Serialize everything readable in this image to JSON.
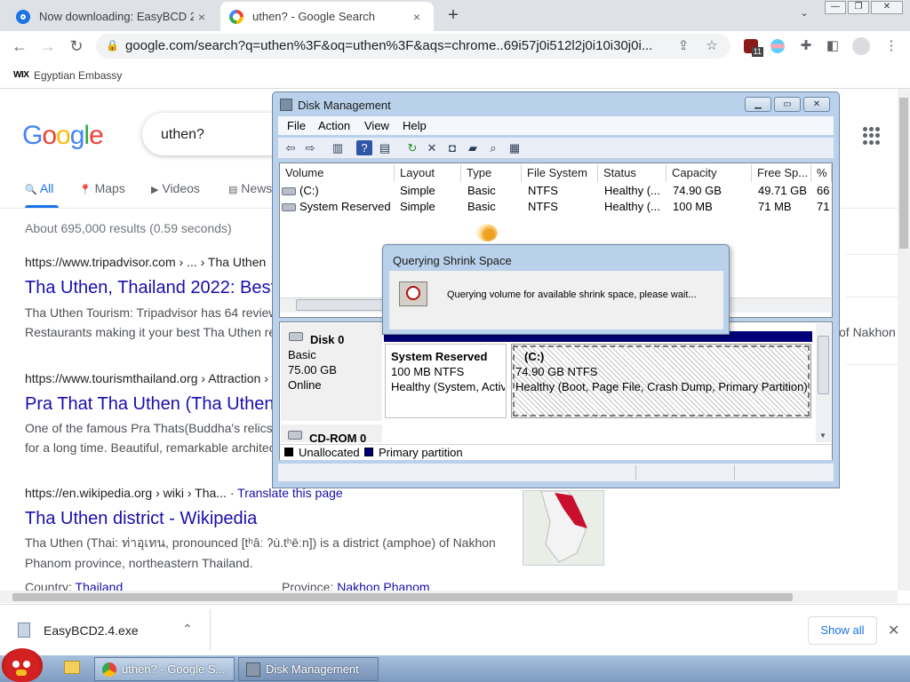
{
  "browser": {
    "tabs": [
      {
        "title": "Now downloading: EasyBCD 2",
        "close": "×"
      },
      {
        "title": "uthen? - Google Search",
        "close": "×"
      }
    ],
    "new_tab": "+",
    "tab_search": "⌄",
    "window_controls": {
      "minimize": "—",
      "restore": "❐",
      "close": "✕"
    },
    "nav": {
      "back": "←",
      "forward": "→",
      "reload": "↻"
    },
    "url": "google.com/search?q=uthen%3F&oq=uthen%3F&aqs=chrome..69i57j0i512l2j0i10i30j0i...",
    "extension_badge": "11",
    "bookmarks": [
      {
        "icon_text": "WIX",
        "label": "Egyptian Embassy"
      }
    ]
  },
  "google": {
    "logo": "Google",
    "query": "uthen?",
    "tabs": [
      "All",
      "Maps",
      "Videos",
      "News"
    ],
    "tab_icons": [
      "🔍",
      "📍",
      "▶",
      "▤"
    ],
    "stats": "About 695,000 results (0.59 seconds)",
    "results": [
      {
        "cite": "https://www.tripadvisor.com › ... › Tha Uthen",
        "title": "Tha Uthen, Thailand 2022: Best",
        "snippet": [
          "Tha Uthen Tourism: Tripadvisor has 64 reviews",
          "Restaurants making it your best Tha Uthen re"
        ]
      },
      {
        "cite": "https://www.tourismthailand.org › Attraction ›",
        "title": "Pra That Tha Uthen (Tha Uthen",
        "snippet": [
          "One of the famous Pra Thats(Buddha's relics",
          "for a long time. Beautiful, remarkable architect"
        ]
      },
      {
        "cite": "https://en.wikipedia.org › wiki › Tha...",
        "translate": "Translate this page",
        "title": "Tha Uthen district - Wikipedia",
        "snippet": [
          "Tha Uthen (Thai: ท่าอุเทน, pronounced [tʰâː ʔù.tʰēːn]) is a district (amphoe) of Nakhon",
          "Phanom province, northeastern Thailand."
        ],
        "meta": {
          "country_label": "Country: ",
          "country": "Thailand",
          "province_label": "Province: ",
          "province": "Nakhon Phanom"
        }
      }
    ],
    "side_text": "of Nakhon"
  },
  "download_shelf": {
    "file": "EasyBCD2.4.exe",
    "show_all": "Show all",
    "close": "✕",
    "chevron": "⌃"
  },
  "taskbar": {
    "items": [
      {
        "label": "uthen? - Google S..."
      },
      {
        "label": "Disk Management"
      }
    ]
  },
  "disk_management": {
    "title": "Disk Management",
    "menu": [
      "File",
      "Action",
      "View",
      "Help"
    ],
    "columns": [
      "Volume",
      "Layout",
      "Type",
      "File System",
      "Status",
      "Capacity",
      "Free Sp...",
      "%"
    ],
    "volumes": [
      [
        "(C:)",
        "Simple",
        "Basic",
        "NTFS",
        "Healthy (...",
        "74.90 GB",
        "49.71 GB",
        "66"
      ],
      [
        "System Reserved",
        "Simple",
        "Basic",
        "NTFS",
        "Healthy (...",
        "100 MB",
        "71 MB",
        "71"
      ]
    ],
    "disk0": {
      "name": "Disk 0",
      "type": "Basic",
      "size": "75.00 GB",
      "state": "Online"
    },
    "partitions": [
      {
        "name": "System Reserved",
        "size": "100 MB NTFS",
        "status": "Healthy (System, Activ"
      },
      {
        "name": "(C:)",
        "size": "74.90 GB NTFS",
        "status": "Healthy (Boot, Page File, Crash Dump, Primary Partition)"
      }
    ],
    "cdrom": "CD-ROM 0",
    "legend": [
      {
        "label": "Unallocated",
        "color": "#000000"
      },
      {
        "label": "Primary partition",
        "color": "#00007a"
      }
    ]
  },
  "dialog": {
    "title": "Querying Shrink Space",
    "message": "Querying volume for available shrink space, please wait..."
  }
}
